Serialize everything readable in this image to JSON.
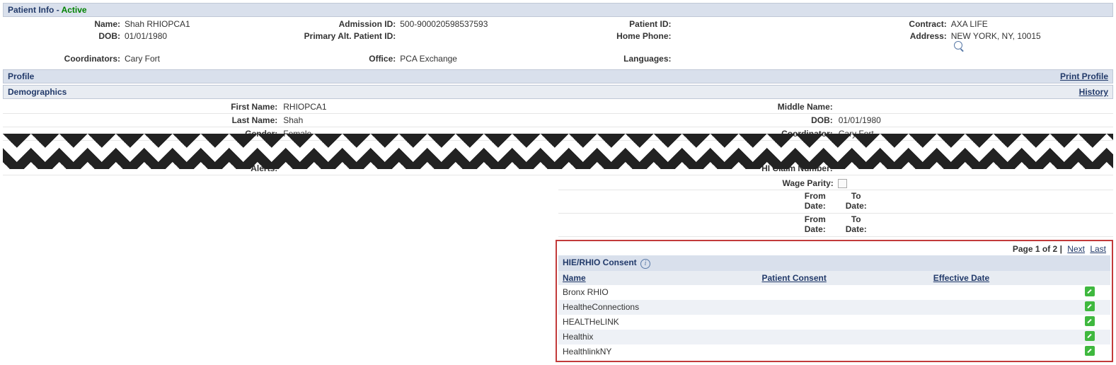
{
  "patientInfo": {
    "headerTitle": "Patient Info",
    "statusDash": " - ",
    "statusText": "Active",
    "labels": {
      "name": "Name:",
      "dob": "DOB:",
      "coordinators": "Coordinators:",
      "admissionId": "Admission ID:",
      "primaryAltPatientId": "Primary Alt. Patient ID:",
      "office": "Office:",
      "patientId": "Patient ID:",
      "homePhone": "Home Phone:",
      "languages": "Languages:",
      "contract": "Contract:",
      "address": "Address:"
    },
    "values": {
      "name": "Shah RHIOPCA1",
      "dob": "01/01/1980",
      "coordinators": "Cary Fort",
      "admissionId": "500-900020598537593",
      "primaryAltPatientId": "",
      "office": "PCA Exchange",
      "patientId": "",
      "homePhone": "",
      "languages": "",
      "contract": "AXA LIFE",
      "address": "NEW YORK, NY, 10015"
    }
  },
  "profile": {
    "header": "Profile",
    "printLink": "Print Profile"
  },
  "demographics": {
    "header": "Demographics",
    "historyLink": "History",
    "rows": {
      "firstName": {
        "label": "First Name:",
        "value": "RHIOPCA1",
        "label2": "Middle Name:",
        "value2": ""
      },
      "lastName": {
        "label": "Last Name:",
        "value": "Shah",
        "label2": "DOB:",
        "value2": "01/01/1980"
      },
      "gender": {
        "label": "Gender:",
        "value": "Female",
        "label2": "Coordinator:",
        "value2": "Cary Fort"
      },
      "alerts": {
        "label": "Alerts:",
        "value": "",
        "label2": "HI Claim Number:",
        "value2": ""
      }
    },
    "wageParity": {
      "label": "Wage Parity:",
      "fromDate": "From\nDate:",
      "toDate": "To\nDate:"
    }
  },
  "consent": {
    "pagerPrefix": "Page ",
    "pagerPage": "1 of 2",
    "pagerSep": " | ",
    "next": "Next",
    "last": "Last",
    "title": "HIE/RHIO Consent",
    "cols": {
      "name": "Name",
      "patientConsent": "Patient Consent",
      "effectiveDate": "Effective Date"
    },
    "rows": [
      {
        "name": "Bronx RHIO"
      },
      {
        "name": "HealtheConnections"
      },
      {
        "name": "HEALTHeLINK"
      },
      {
        "name": "Healthix"
      },
      {
        "name": "HealthlinkNY"
      }
    ]
  }
}
